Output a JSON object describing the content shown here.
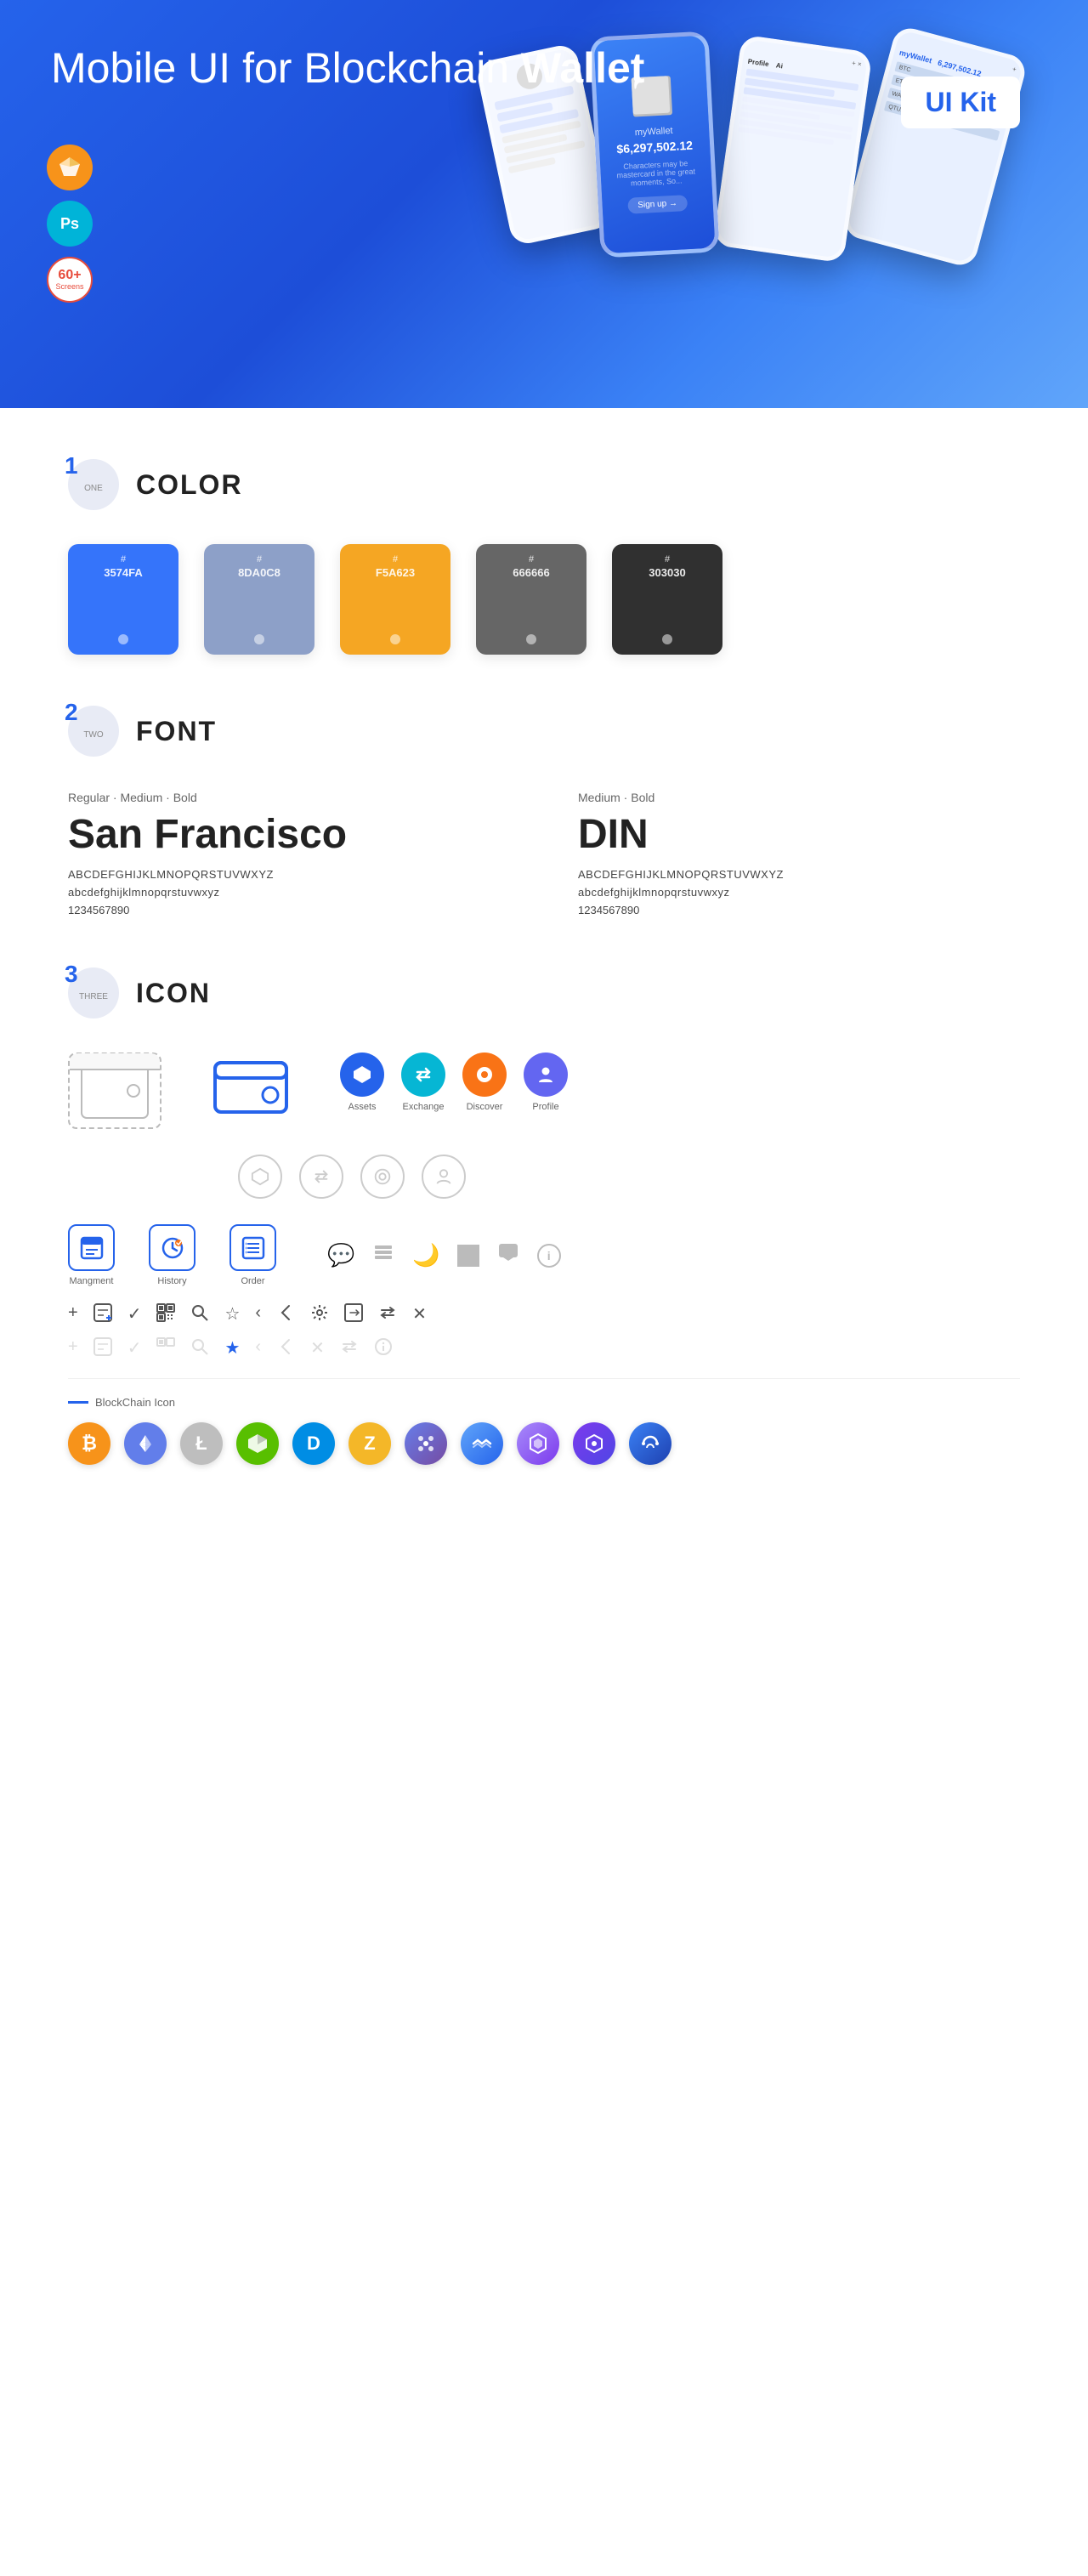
{
  "hero": {
    "title_normal": "Mobile UI for Blockchain",
    "title_bold": "Wallet",
    "ui_kit_label": "UI Kit",
    "badge_sketch": "S",
    "badge_ps": "Ps",
    "badge_screens_count": "60+",
    "badge_screens_label": "Screens"
  },
  "sections": {
    "color": {
      "number": "1",
      "number_label": "ONE",
      "title": "COLOR",
      "swatches": [
        {
          "code": "#",
          "hex": "3574FA",
          "color": "#3574FA"
        },
        {
          "code": "#",
          "hex": "8DA0C8",
          "color": "#8DA0C8"
        },
        {
          "code": "#",
          "hex": "F5A623",
          "color": "#F5A623"
        },
        {
          "code": "#",
          "hex": "666666",
          "color": "#666666"
        },
        {
          "code": "#",
          "hex": "303030",
          "color": "#303030"
        }
      ]
    },
    "font": {
      "number": "2",
      "number_label": "TWO",
      "title": "FONT",
      "font1": {
        "styles": "Regular · Medium · Bold",
        "name": "San Francisco",
        "upper": "ABCDEFGHIJKLMNOPQRSTUVWXYZ",
        "lower": "abcdefghijklmnopqrstuvwxyz",
        "numbers": "1234567890"
      },
      "font2": {
        "styles": "Medium · Bold",
        "name": "DIN",
        "upper": "ABCDEFGHIJKLMNOPQRSTUVWXYZ",
        "lower": "abcdefghijklmnopqrstuvwxyz",
        "numbers": "1234567890"
      }
    },
    "icon": {
      "number": "3",
      "number_label": "THREE",
      "title": "ICON",
      "colored_icons": [
        {
          "label": "Assets",
          "symbol": "◆"
        },
        {
          "label": "Exchange",
          "symbol": "⇄"
        },
        {
          "label": "Discover",
          "symbol": "●"
        },
        {
          "label": "Profile",
          "symbol": "⌒"
        }
      ],
      "outline_icons": [
        {
          "label": "",
          "symbol": "◆"
        },
        {
          "label": "",
          "symbol": "⇄"
        },
        {
          "label": "",
          "symbol": "●"
        },
        {
          "label": "",
          "symbol": "⌒"
        }
      ],
      "mgmt_icons": [
        {
          "label": "Mangment",
          "type": "blue"
        },
        {
          "label": "History",
          "type": "blue"
        },
        {
          "label": "Order",
          "type": "blue"
        }
      ],
      "misc_icons": [
        "▬",
        "≡",
        "◐",
        "●",
        "▭",
        "ⓘ"
      ],
      "tool_icons_row1": [
        "+",
        "⊞",
        "✓",
        "⊡",
        "⌕",
        "☆",
        "‹",
        "≺",
        "⚙",
        "⬒",
        "⇌",
        "✕"
      ],
      "tool_icons_row2": [
        "+",
        "⊞",
        "✓",
        "⊡",
        "⌕",
        "☆",
        "‹",
        "≺",
        "⊕",
        "⇌",
        "✕"
      ],
      "blockchain_label": "BlockChain Icon",
      "crypto_icons": [
        {
          "symbol": "₿",
          "name": "Bitcoin",
          "class": "crypto-btc"
        },
        {
          "symbol": "Ξ",
          "name": "Ethereum",
          "class": "crypto-eth"
        },
        {
          "symbol": "Ł",
          "name": "Litecoin",
          "class": "crypto-ltc"
        },
        {
          "symbol": "N",
          "name": "NEO",
          "class": "crypto-neo"
        },
        {
          "symbol": "D",
          "name": "Dash",
          "class": "crypto-dash"
        },
        {
          "symbol": "Z",
          "name": "Zcash",
          "class": "crypto-zcash"
        },
        {
          "symbol": "⬡",
          "name": "Grid",
          "class": "crypto-grid"
        },
        {
          "symbol": "W",
          "name": "Waves",
          "class": "crypto-waves"
        },
        {
          "symbol": "◈",
          "name": "Purple",
          "class": "crypto-purple"
        },
        {
          "symbol": "◇",
          "name": "Poly",
          "class": "crypto-poly"
        },
        {
          "symbol": "∞",
          "name": "Celo",
          "class": "crypto-celo"
        }
      ]
    }
  }
}
